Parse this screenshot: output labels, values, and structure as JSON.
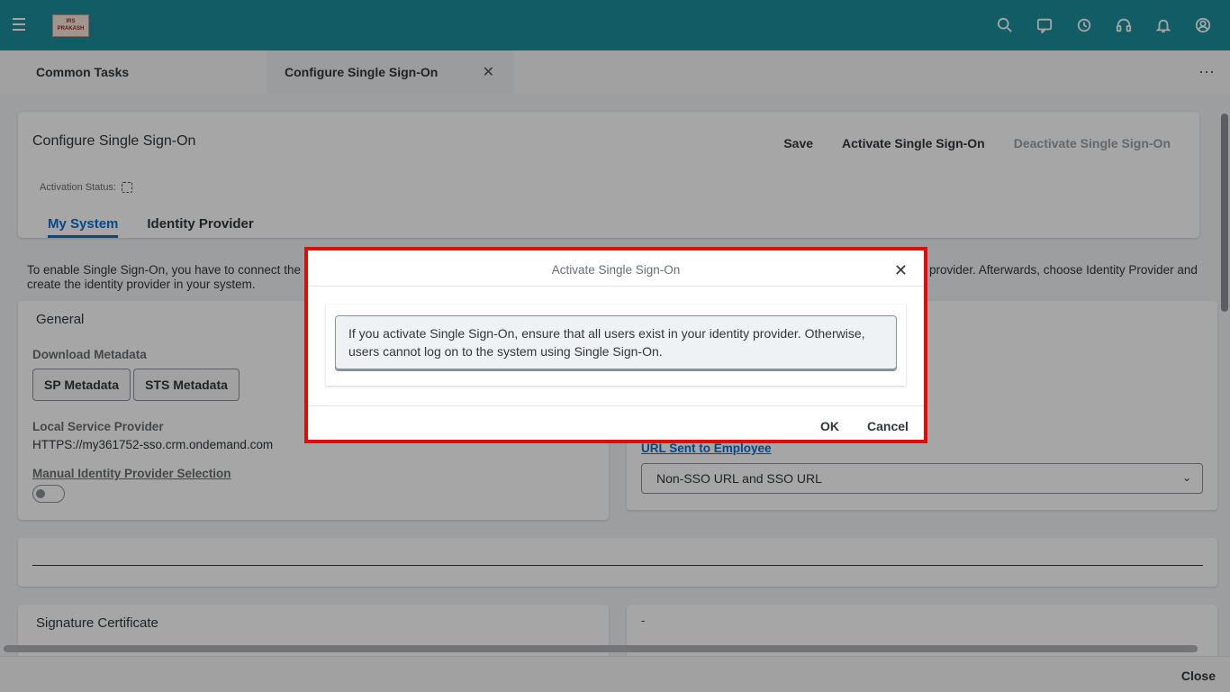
{
  "shell": {
    "logo_text": "IRS PRAKASH",
    "icons": [
      "search-icon",
      "feedback-icon",
      "history-icon",
      "headset-icon",
      "bell-icon",
      "user-icon"
    ]
  },
  "tabs": [
    {
      "label": "Common Tasks"
    },
    {
      "label": "Configure Single Sign-On",
      "close": "✕"
    }
  ],
  "more": "⋯",
  "header": {
    "title": "Configure Single Sign-On",
    "actions": {
      "save": "Save",
      "activate": "Activate Single Sign-On",
      "deactivate": "Deactivate Single Sign-On"
    },
    "activation_status_label": "Activation Status:",
    "subtabs": [
      "My System",
      "Identity Provider"
    ]
  },
  "intro": {
    "left": "To enable Single Sign-On, you have to connect the",
    "right": "provider. Afterwards, choose Identity Provider and",
    "line2": "create the identity provider in your system."
  },
  "general": {
    "title": "General",
    "download_metadata_label": "Download Metadata",
    "sp_metadata_button": "SP Metadata",
    "sts_metadata_button": "STS Metadata",
    "local_sp_label": "Local Service Provider",
    "local_sp_value": "HTTPS://my361752-sso.crm.ondemand.com",
    "manual_idp_label": "Manual Identity Provider Selection"
  },
  "right_panel": {
    "url_sent_label": "URL Sent to Employee",
    "url_sent_value": "Non-SSO URL and SSO URL",
    "chevron": "⌄"
  },
  "signature": {
    "title": "Signature Certificate",
    "right_value": "-"
  },
  "footer": {
    "close": "Close"
  },
  "dialog": {
    "title": "Activate Single Sign-On",
    "close": "✕",
    "message_line1": "If you activate Single Sign-On, ensure that all users exist in your identity provider. Otherwise,",
    "message_line2": "users cannot log on to the system using Single Sign-On.",
    "ok": "OK",
    "cancel": "Cancel",
    "highlight_color": "#e30a0a"
  }
}
